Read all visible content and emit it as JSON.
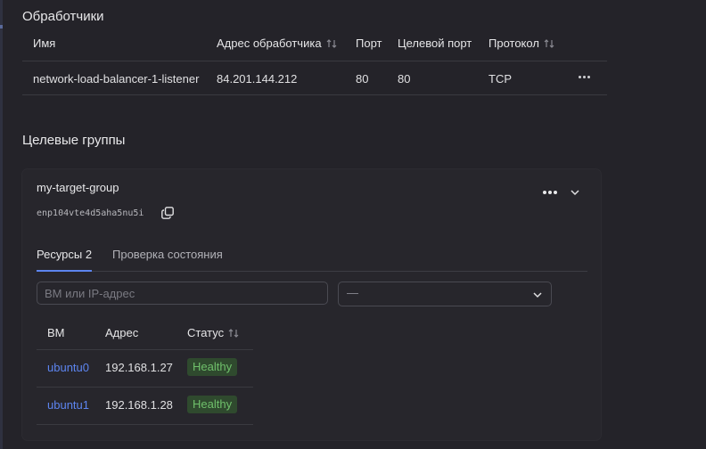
{
  "listeners": {
    "title": "Обработчики",
    "columns": [
      "Имя",
      "Адрес обработчика",
      "Порт",
      "Целевой порт",
      "Протокол"
    ],
    "rows": [
      {
        "name": "network-load-balancer-1-listener",
        "address": "84.201.144.212",
        "port": "80",
        "target_port": "80",
        "protocol": "TCP"
      }
    ]
  },
  "target_groups": {
    "title": "Целевые группы",
    "group": {
      "name": "my-target-group",
      "id": "enp104vte4d5aha5nu5i",
      "tabs": [
        {
          "label": "Ресурсы 2",
          "active": true
        },
        {
          "label": "Проверка состояния",
          "active": false
        }
      ],
      "search_placeholder": "ВМ или IP-адрес",
      "status_filter_value": "—",
      "columns": [
        "ВМ",
        "Адрес",
        "Статус"
      ],
      "rows": [
        {
          "vm": "ubuntu0",
          "address": "192.168.1.27",
          "status": "Healthy"
        },
        {
          "vm": "ubuntu1",
          "address": "192.168.1.28",
          "status": "Healthy"
        }
      ]
    }
  },
  "colors": {
    "background": "#242329",
    "link": "#5d85f0",
    "healthy_text": "#6fc06b",
    "healthy_bg": "#2f4a2e"
  },
  "icons": [
    "sort-icon",
    "more-icon",
    "copy-icon",
    "chevron-down-icon"
  ]
}
